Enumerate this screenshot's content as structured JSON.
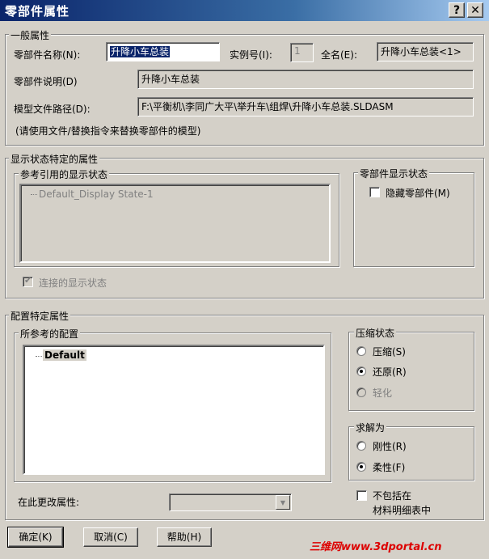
{
  "window": {
    "title": "零部件属性",
    "help_btn": "?",
    "close_btn": "✕"
  },
  "general": {
    "legend": "一般属性",
    "name_label": "零部件名称(N):",
    "name_value": "升降小车总装",
    "instance_label": "实例号(I):",
    "instance_value": "1",
    "fullname_label": "全名(E):",
    "fullname_value": "升降小车总装<1>",
    "desc_label": "零部件说明(D)",
    "desc_value": "升降小车总装",
    "path_label": "模型文件路径(D):",
    "path_value": "F:\\平衡机\\李同广大平\\举升车\\组焊\\升降小车总装.SLDASM",
    "hint": "(请使用文件/替换指令来替换零部件的模型)"
  },
  "display": {
    "legend": "显示状态特定的属性",
    "ref_legend": "参考引用的显示状态",
    "ref_item": "Default_Display State-1",
    "comp_legend": "零部件显示状态",
    "hide_label": "隐藏零部件(M)",
    "hide_checked": false,
    "linked_label": "连接的显示状态",
    "linked_checked": true
  },
  "config": {
    "legend": "配置特定属性",
    "ref_legend": "所参考的配置",
    "ref_item": "Default",
    "suppress_legend": "压缩状态",
    "suppress_options": [
      "压缩(S)",
      "还原(R)",
      "轻化"
    ],
    "suppress_selected": "还原(R)",
    "solve_legend": "求解为",
    "solve_options": [
      "刚性(R)",
      "柔性(F)"
    ],
    "solve_selected": "柔性(F)",
    "change_label": "在此更改属性:",
    "exclude_label_line1": "不包括在",
    "exclude_label_line2": "材料明细表中",
    "exclude_checked": false
  },
  "buttons": {
    "ok": "确定(K)",
    "cancel": "取消(C)",
    "help": "帮助(H)"
  },
  "watermark": "三维网www.3dportal.cn",
  "icons": {
    "combo_arrow": "chevron-down-icon",
    "check": "check-icon"
  }
}
